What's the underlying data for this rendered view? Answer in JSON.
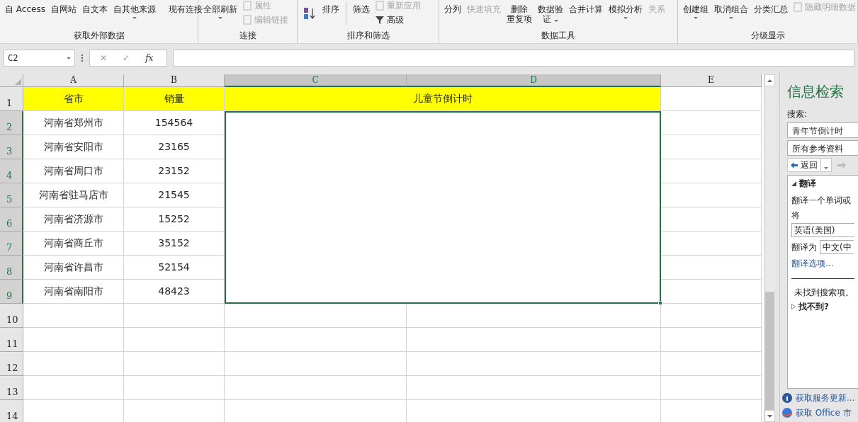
{
  "ribbon": {
    "groups": [
      {
        "label": "获取外部数据",
        "items": [
          {
            "kind": "large",
            "lines": [
              "自 Access"
            ],
            "disabled": false,
            "dropdown": false
          },
          {
            "kind": "large",
            "lines": [
              "自网站"
            ],
            "disabled": false,
            "dropdown": false
          },
          {
            "kind": "large",
            "lines": [
              "自文本"
            ],
            "disabled": false,
            "dropdown": false
          },
          {
            "kind": "large",
            "lines": [
              "自其他来源"
            ],
            "disabled": false,
            "dropdown": true
          },
          {
            "kind": "separator"
          },
          {
            "kind": "large",
            "lines": [
              "现有连接"
            ],
            "disabled": false,
            "dropdown": false
          }
        ]
      },
      {
        "label": "连接",
        "items": [
          {
            "kind": "large",
            "lines": [
              "全部刷新"
            ],
            "disabled": false,
            "dropdown": true
          },
          {
            "kind": "stack",
            "buttons": [
              {
                "label": "属性",
                "disabled": true
              },
              {
                "label": "编辑链接",
                "disabled": true
              }
            ]
          }
        ]
      },
      {
        "label": "排序和筛选",
        "items": [
          {
            "kind": "sort-icon"
          },
          {
            "kind": "large",
            "lines": [
              "排序"
            ],
            "disabled": false,
            "dropdown": false
          },
          {
            "kind": "separator"
          },
          {
            "kind": "large",
            "lines": [
              "筛选"
            ],
            "disabled": false,
            "dropdown": false
          },
          {
            "kind": "stack",
            "buttons": [
              {
                "label": "重新应用",
                "disabled": true
              },
              {
                "label": "高级",
                "disabled": false
              }
            ]
          }
        ]
      },
      {
        "label": "数据工具",
        "items": [
          {
            "kind": "large",
            "lines": [
              "分列"
            ],
            "disabled": false,
            "dropdown": false
          },
          {
            "kind": "large",
            "lines": [
              "快速填充"
            ],
            "disabled": true,
            "dropdown": false
          },
          {
            "kind": "large",
            "lines": [
              "删除",
              "重复项"
            ],
            "disabled": false,
            "dropdown": false
          },
          {
            "kind": "large",
            "lines": [
              "数据验",
              "证"
            ],
            "disabled": false,
            "dropdown": true
          },
          {
            "kind": "large",
            "lines": [
              "合并计算"
            ],
            "disabled": false,
            "dropdown": false
          },
          {
            "kind": "large",
            "lines": [
              "模拟分析"
            ],
            "disabled": false,
            "dropdown": true
          },
          {
            "kind": "large",
            "lines": [
              "关系"
            ],
            "disabled": true,
            "dropdown": false
          }
        ]
      },
      {
        "label": "分级显示",
        "items": [
          {
            "kind": "large",
            "lines": [
              "创建组"
            ],
            "disabled": false,
            "dropdown": true
          },
          {
            "kind": "large",
            "lines": [
              "取消组合"
            ],
            "disabled": false,
            "dropdown": true
          },
          {
            "kind": "large",
            "lines": [
              "分类汇总"
            ],
            "disabled": false,
            "dropdown": false
          },
          {
            "kind": "stack",
            "buttons": [
              {
                "label": "隐藏明细数据",
                "disabled": true
              }
            ]
          }
        ]
      }
    ]
  },
  "formula_bar": {
    "name_box": "C2",
    "cancel": "✕",
    "enter": "✓",
    "function": "fx"
  },
  "sheet": {
    "columns": [
      {
        "label": "A",
        "selected": false
      },
      {
        "label": "B",
        "selected": false
      },
      {
        "label": "C",
        "selected": true
      },
      {
        "label": "D",
        "selected": true
      },
      {
        "label": "E",
        "selected": false
      }
    ],
    "title": {
      "cells": [
        {
          "text": "省市"
        },
        {
          "text": "销量"
        }
      ],
      "merged_title": "儿童节倒计时",
      "highlighted": true
    },
    "rows": [
      {
        "number": "1",
        "selected": false
      },
      {
        "number": "2",
        "selected": true,
        "province": "河南省郑州市",
        "sales": "154564"
      },
      {
        "number": "3",
        "selected": true,
        "province": "河南省安阳市",
        "sales": "23165"
      },
      {
        "number": "4",
        "selected": true,
        "province": "河南省周口市",
        "sales": "23152"
      },
      {
        "number": "5",
        "selected": true,
        "province": "河南省驻马店市",
        "sales": "21545"
      },
      {
        "number": "6",
        "selected": true,
        "province": "河南省济源市",
        "sales": "15252"
      },
      {
        "number": "7",
        "selected": true,
        "province": "河南省商丘市",
        "sales": "35152"
      },
      {
        "number": "8",
        "selected": true,
        "province": "河南省许昌市",
        "sales": "52154"
      },
      {
        "number": "9",
        "selected": true,
        "province": "河南省南阳市",
        "sales": "48423"
      },
      {
        "number": "10",
        "selected": false
      },
      {
        "number": "11",
        "selected": false
      },
      {
        "number": "12",
        "selected": false
      },
      {
        "number": "13",
        "selected": false
      },
      {
        "number": "14",
        "selected": false
      }
    ]
  },
  "research_pane": {
    "title": "信息检索",
    "search_label": "搜索:",
    "search_value": "青年节倒计时",
    "source": "所有参考资料",
    "back": "返回",
    "section": {
      "title": "翻译",
      "expanded": true,
      "description": "翻译一个单词或",
      "from_label": "将",
      "from": "英语(美国)",
      "to_label": "翻译为",
      "to": "中文(中",
      "options_link": "翻译选项...",
      "not_found": "未找到搜索项。",
      "cant_find": "找不到?"
    },
    "links": [
      "获取服务更新...",
      "获取 Office 市"
    ]
  }
}
